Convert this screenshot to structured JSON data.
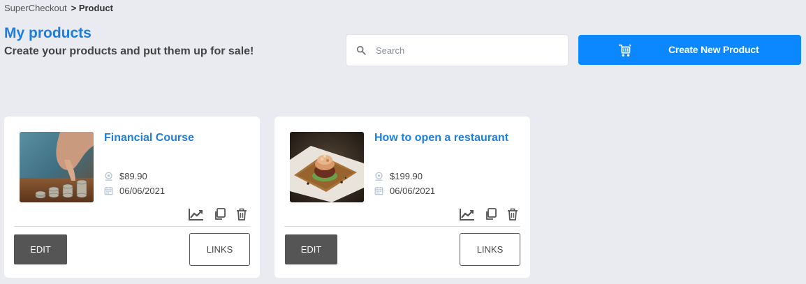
{
  "breadcrumb": {
    "root": "SuperCheckout",
    "current": "> Product"
  },
  "header": {
    "title": "My products",
    "subtitle": "Create your products and put them up for sale!"
  },
  "search": {
    "placeholder": "Search",
    "value": "",
    "icon": "search-icon"
  },
  "create_button": {
    "label": "Create New Product",
    "icon": "cart-icon"
  },
  "colors": {
    "accent": "#0b87ff",
    "title_blue": "#1d7ee0",
    "page_bg": "#e9ebf0",
    "edit_bg": "#555555"
  },
  "products": [
    {
      "title": "Financial Course",
      "price": "$89.90",
      "date": "06/06/2021",
      "image": "coins-photo",
      "edit_label": "EDIT",
      "links_label": "LINKS"
    },
    {
      "title": "How to open a restaurant",
      "price": "$199.90",
      "date": "06/06/2021",
      "image": "food-plate-photo",
      "edit_label": "EDIT",
      "links_label": "LINKS"
    }
  ]
}
